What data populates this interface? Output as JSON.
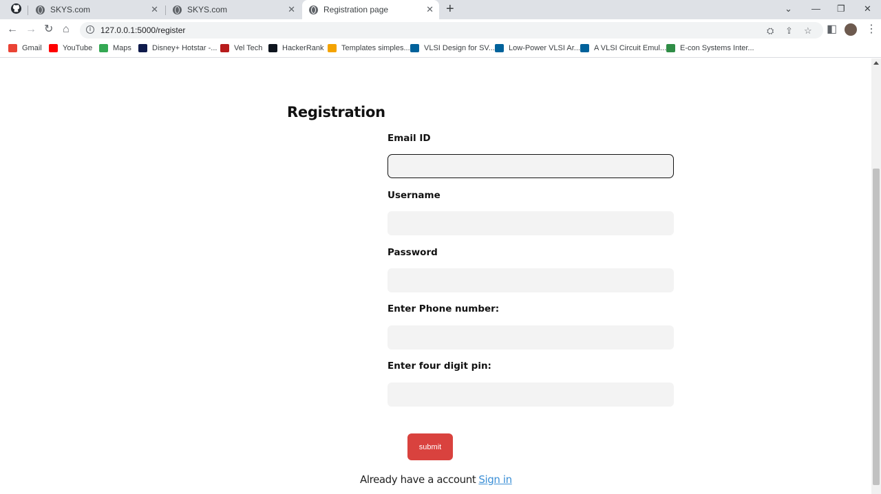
{
  "browser": {
    "tabs": [
      {
        "title": "SKYS.com",
        "active": false
      },
      {
        "title": "SKYS.com",
        "active": false
      },
      {
        "title": "Registration page",
        "active": true
      }
    ],
    "url": "127.0.0.1:5000/register",
    "bookmarks": [
      {
        "label": "Gmail",
        "icon": "gmail-icon",
        "color": "#ea4335"
      },
      {
        "label": "YouTube",
        "icon": "youtube-icon",
        "color": "#ff0000"
      },
      {
        "label": "Maps",
        "icon": "maps-icon",
        "color": "#34a853"
      },
      {
        "label": "Disney+ Hotstar -...",
        "icon": "hotstar-icon",
        "color": "#0f1b4c"
      },
      {
        "label": "Vel Tech",
        "icon": "veltech-icon",
        "color": "#b71c1c"
      },
      {
        "label": "HackerRank",
        "icon": "hackerrank-icon",
        "color": "#0e141e"
      },
      {
        "label": "Templates simples...",
        "icon": "templates-icon",
        "color": "#f4a300"
      },
      {
        "label": "VLSI Design for SV...",
        "icon": "ieee-icon",
        "color": "#00629b"
      },
      {
        "label": "Low-Power VLSI Ar...",
        "icon": "ieee-icon",
        "color": "#00629b"
      },
      {
        "label": "A VLSI Circuit Emul...",
        "icon": "ieee-icon",
        "color": "#00629b"
      },
      {
        "label": "E-con Systems Inter...",
        "icon": "geeks-icon",
        "color": "#2f8d46"
      }
    ]
  },
  "page": {
    "title": "Registration",
    "fields": [
      {
        "label": "Email ID",
        "value": "",
        "focused": true
      },
      {
        "label": "Username",
        "value": "",
        "focused": false
      },
      {
        "label": "Password",
        "value": "",
        "focused": false
      },
      {
        "label": "Enter Phone number:",
        "value": "",
        "focused": false
      },
      {
        "label": "Enter four digit pin:",
        "value": "",
        "focused": false
      }
    ],
    "submit_label": "submit",
    "signin_prompt": "Already have a account",
    "signin_link": "Sign in"
  },
  "colors": {
    "submit_bg": "#d9423e",
    "link": "#3b8fd6",
    "input_bg": "#f3f3f3"
  }
}
